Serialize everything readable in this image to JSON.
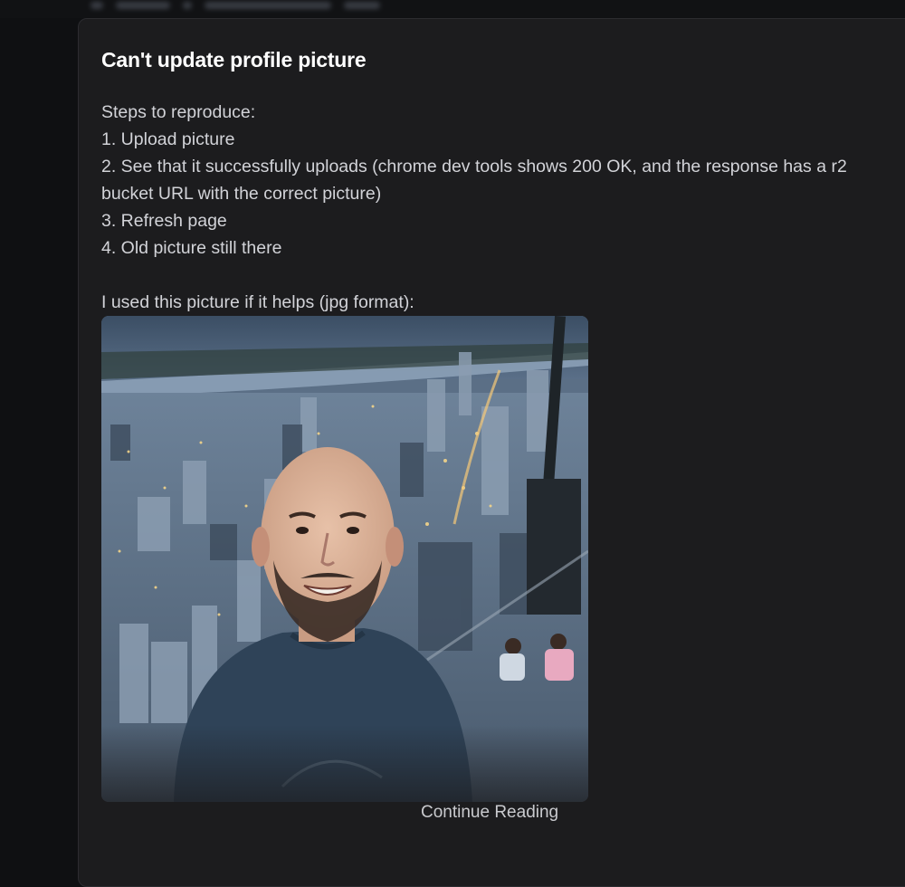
{
  "post": {
    "title": "Can't update profile picture",
    "body_lines": [
      "Steps to reproduce:",
      "1. Upload picture",
      "2. See that it successfully uploads (chrome dev tools shows 200 OK, and the response has a r2 bucket URL with the correct picture)",
      "3. Refresh page",
      "4. Old picture still there"
    ],
    "attachment_intro": "I used this picture if it helps (jpg format):",
    "continue_label": "Continue Reading"
  },
  "colors": {
    "page_bg": "#0f1012",
    "card_bg": "#1c1c1e",
    "title": "#ffffff",
    "body_text": "#d2d3d8"
  }
}
